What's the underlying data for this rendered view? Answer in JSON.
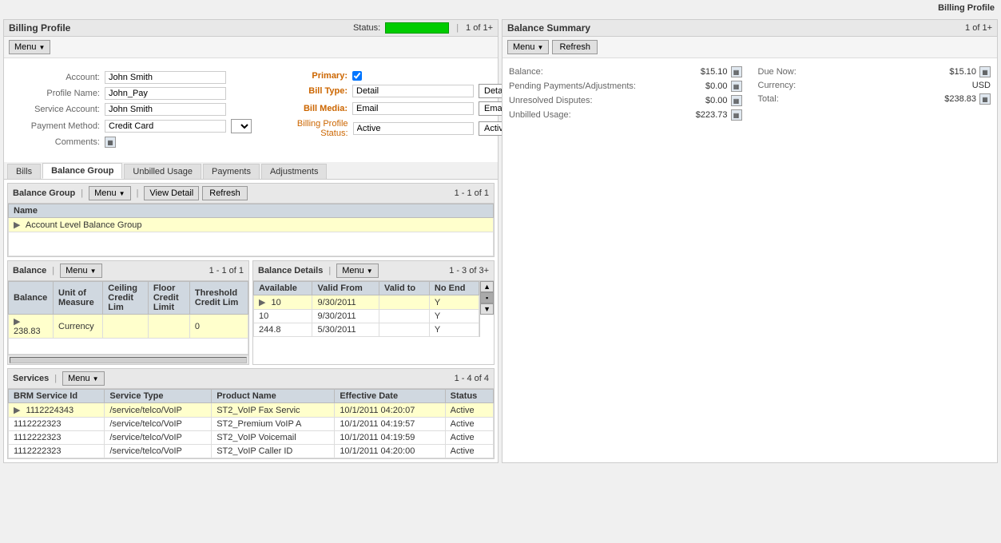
{
  "page": {
    "top_title": "Billing Profile"
  },
  "billing_profile": {
    "title": "Billing Profile",
    "status_label": "Status:",
    "page_count": "1 of 1+",
    "menu_label": "Menu",
    "account_label": "Account:",
    "account_value": "John Smith",
    "profile_name_label": "Profile Name:",
    "profile_name_value": "John_Pay",
    "service_account_label": "Service Account:",
    "service_account_value": "John Smith",
    "payment_method_label": "Payment Method:",
    "payment_method_value": "Credit Card",
    "comments_label": "Comments:",
    "primary_label": "Primary:",
    "bill_type_label": "Bill Type:",
    "bill_type_value": "Detail",
    "bill_media_label": "Bill Media:",
    "bill_media_value": "Email",
    "billing_profile_status_label": "Billing Profile Status:",
    "billing_profile_status_value": "Active"
  },
  "balance_summary": {
    "title": "Balance Summary",
    "page_count": "1 of 1+",
    "menu_label": "Menu",
    "refresh_label": "Refresh",
    "balance_label": "Balance:",
    "balance_value": "$15.10",
    "pending_label": "Pending Payments/Adjustments:",
    "pending_value": "$0.00",
    "unresolved_label": "Unresolved Disputes:",
    "unresolved_value": "$0.00",
    "unbilled_label": "Unbilled Usage:",
    "unbilled_value": "$223.73",
    "due_now_label": "Due Now:",
    "due_now_value": "$15.10",
    "currency_label": "Currency:",
    "currency_value": "USD",
    "total_label": "Total:",
    "total_value": "$238.83"
  },
  "tabs": {
    "bills": "Bills",
    "balance_group": "Balance Group",
    "unbilled_usage": "Unbilled Usage",
    "payments": "Payments",
    "adjustments": "Adjustments"
  },
  "balance_group": {
    "title": "Balance Group",
    "menu_label": "Menu",
    "view_detail_label": "View Detail",
    "refresh_label": "Refresh",
    "page_count": "1 - 1 of 1",
    "col_name": "Name",
    "rows": [
      {
        "name": "Account Level Balance Group",
        "selected": true
      }
    ]
  },
  "balance": {
    "title": "Balance",
    "menu_label": "Menu",
    "page_count": "1 - 1 of 1",
    "cols": [
      "Balance",
      "Unit of Measure",
      "Ceiling Credit Lim",
      "Floor Credit Limit",
      "Threshold Credit Lim"
    ],
    "rows": [
      {
        "balance": "238.83",
        "unit": "Currency",
        "ceiling": "",
        "floor": "",
        "threshold": "0",
        "selected": true
      }
    ]
  },
  "balance_details": {
    "title": "Balance Details",
    "menu_label": "Menu",
    "page_count": "1 - 3 of 3+",
    "cols": [
      "Available",
      "Valid From",
      "Valid to",
      "No End"
    ],
    "rows": [
      {
        "available": "10",
        "valid_from": "9/30/2011",
        "valid_to": "",
        "no_end": "Y",
        "selected": true
      },
      {
        "available": "10",
        "valid_from": "9/30/2011",
        "valid_to": "",
        "no_end": "Y",
        "selected": false
      },
      {
        "available": "244.8",
        "valid_from": "5/30/2011",
        "valid_to": "",
        "no_end": "Y",
        "selected": false
      }
    ]
  },
  "services": {
    "title": "Services",
    "menu_label": "Menu",
    "page_count": "1 - 4 of 4",
    "cols": [
      "BRM Service Id",
      "Service Type",
      "Product Name",
      "Effective Date",
      "Status"
    ],
    "rows": [
      {
        "id": "1112224343",
        "type": "/service/telco/VoIP",
        "product": "ST2_VoIP Fax Servic",
        "date": "10/1/2011 04:20:07",
        "status": "Active",
        "selected": true
      },
      {
        "id": "1112222323",
        "type": "/service/telco/VoIP",
        "product": "ST2_Premium VoIP A",
        "date": "10/1/2011 04:19:57",
        "status": "Active",
        "selected": false
      },
      {
        "id": "1112222323",
        "type": "/service/telco/VoIP",
        "product": "ST2_VoIP Voicemail",
        "date": "10/1/2011 04:19:59",
        "status": "Active",
        "selected": false
      },
      {
        "id": "1112222323",
        "type": "/service/telco/VoIP",
        "product": "ST2_VoIP Caller ID",
        "date": "10/1/2011 04:20:00",
        "status": "Active",
        "selected": false
      }
    ]
  }
}
